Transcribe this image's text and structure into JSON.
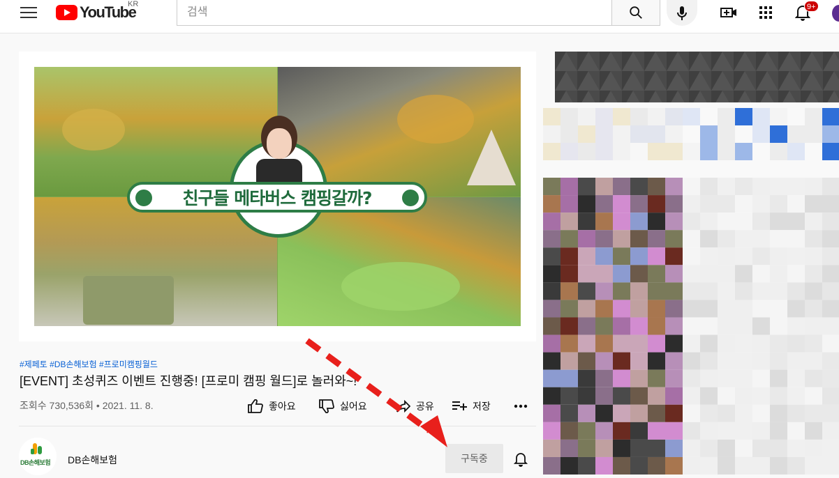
{
  "header": {
    "logo_text": "YouTube",
    "region": "KR",
    "search_placeholder": "검색",
    "notification_count": "9+"
  },
  "video": {
    "thumbnail_banner": "친구들 메타버스 캠핑갈까?",
    "hashtags": "#제페토 #DB손해보험 #프로미캠핑월드",
    "title": "[EVENT] 초성퀴즈 이벤트 진행중! [프로미 캠핑 월드]로 놀러와~!",
    "meta": "조회수 730,536회 • 2021. 11. 8.",
    "actions": {
      "like": "좋아요",
      "dislike": "싫어요",
      "share": "공유",
      "save": "저장"
    }
  },
  "channel": {
    "logo_text": "DB손해보험",
    "name": "DB손해보험",
    "subscribe_label": "구독중"
  },
  "colors": {
    "brand_red": "#ff0000",
    "accent_link": "#065fd4",
    "arrow_red": "#e8201c",
    "banner_green": "#2e7d46"
  }
}
